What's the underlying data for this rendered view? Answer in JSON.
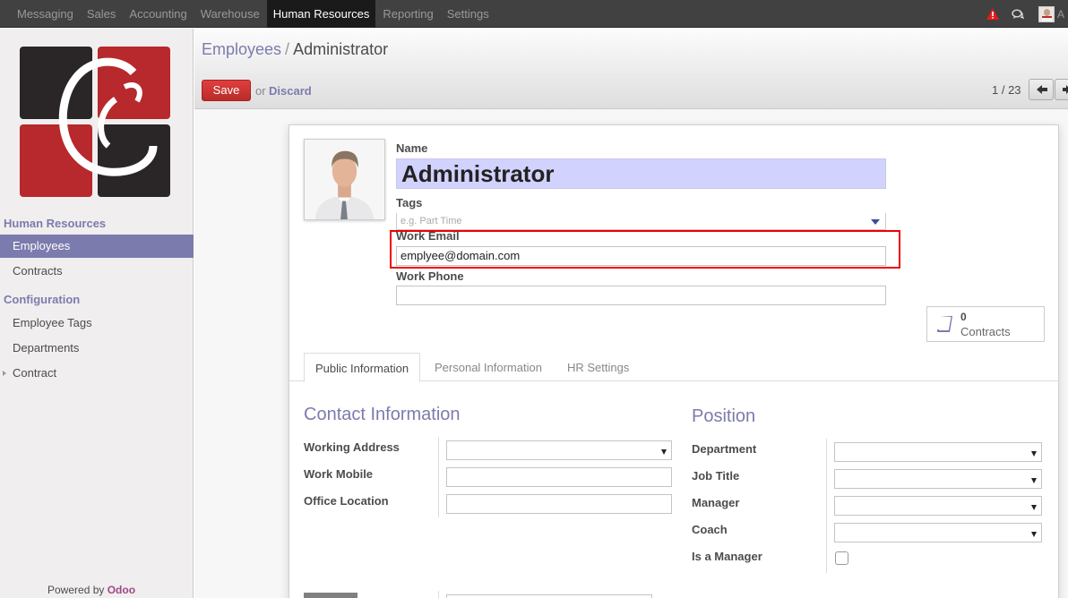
{
  "topbar": {
    "menu": [
      "Messaging",
      "Sales",
      "Accounting",
      "Warehouse",
      "Human Resources",
      "Reporting",
      "Settings"
    ],
    "active_menu": "Human Resources",
    "user_initial": "A"
  },
  "sidebar": {
    "section1": "Human Resources",
    "items1": [
      "Employees",
      "Contracts"
    ],
    "section2": "Configuration",
    "items2": [
      "Employee Tags",
      "Departments",
      "Contract"
    ],
    "powered_by": "Powered by",
    "brand": "Odoo"
  },
  "header": {
    "breadcrumb_parent": "Employees",
    "breadcrumb_sep": "/",
    "breadcrumb_current": "Administrator",
    "save_label": "Save",
    "or_label": "or",
    "discard_label": "Discard",
    "pager": "1 / 23"
  },
  "form": {
    "name_label": "Name",
    "name_value": "Administrator",
    "tags_label": "Tags",
    "tags_placeholder": "e.g. Part Time",
    "work_email_label": "Work Email",
    "work_email_value": "emplyee@domain.com",
    "work_phone_label": "Work Phone",
    "work_phone_value": "",
    "contracts_count": "0",
    "contracts_label": "Contracts"
  },
  "tabs": [
    "Public Information",
    "Personal Information",
    "HR Settings"
  ],
  "contact": {
    "title": "Contact Information",
    "fields": [
      "Working Address",
      "Work Mobile",
      "Office Location"
    ]
  },
  "position": {
    "title": "Position",
    "fields": [
      "Department",
      "Job Title",
      "Manager",
      "Coach",
      "Is a Manager"
    ]
  },
  "colors": {
    "accent": "#7c7bad",
    "save": "#d9534f",
    "highlight": "#ee0000"
  }
}
